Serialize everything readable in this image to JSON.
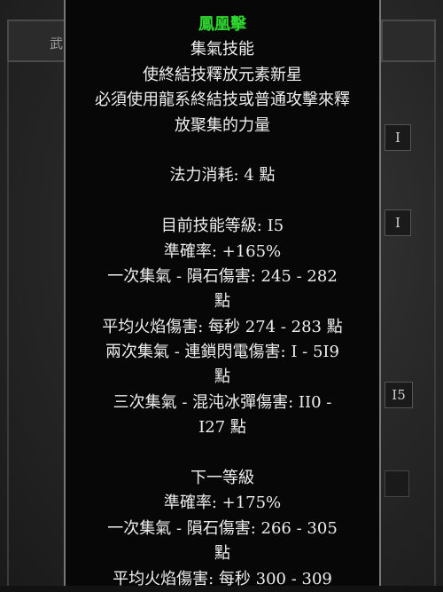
{
  "background": {
    "tab_label": "武",
    "slots": [
      "I",
      "I",
      "I5"
    ]
  },
  "tooltip": {
    "title": "鳳凰擊",
    "description": [
      "集氣技能",
      "使終結技釋放元素新星",
      "必須使用龍系終結技或普通攻擊來釋",
      "放聚集的力量"
    ],
    "mana_cost": "法力消耗: 4 點",
    "current_level": {
      "level": "目前技能等級: I5",
      "attack_rating": "準確率: +165%",
      "charge1": [
        "一次集氣 - 隕石傷害: 245 - 282",
        "點"
      ],
      "fire_damage": "平均火焰傷害: 每秒 274 - 283 點",
      "charge2": [
        "兩次集氣 - 連鎖閃電傷害: I - 5I9",
        "點"
      ],
      "charge3": [
        "三次集氣 - 混沌冰彈傷害: II0 -",
        "I27 點"
      ]
    },
    "next_level": {
      "header": "下一等級",
      "attack_rating": "準確率: +175%",
      "charge1": [
        "一次集氣 - 隕石傷害: 266 - 305",
        "點"
      ],
      "fire_damage": "平均火焰傷害: 每秒 300 - 309"
    }
  },
  "colors": {
    "title": "#2fd62f",
    "text": "#eeeeee"
  }
}
